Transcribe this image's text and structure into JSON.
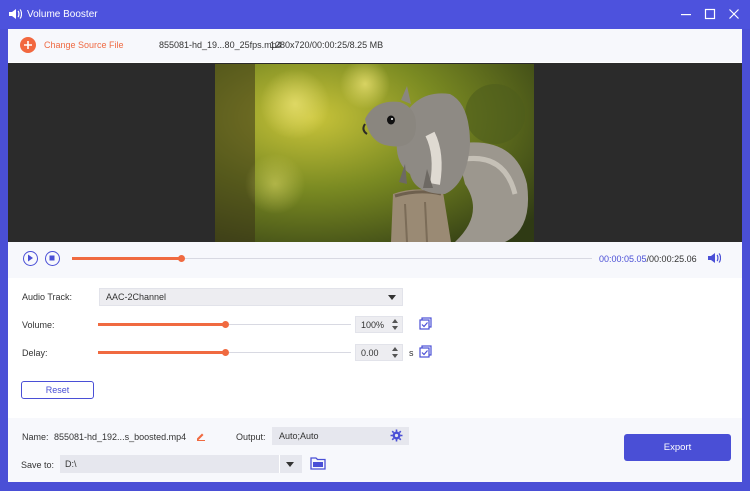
{
  "window": {
    "title": "Volume Booster"
  },
  "source": {
    "change_label": "Change Source File",
    "file_name": "855081-hd_19...80_25fps.mp4",
    "file_info": "1280x720/00:00:25/8.25 MB"
  },
  "player": {
    "current_time": "00:00:05.05",
    "total_time": "/00:00:25.06",
    "progress": 0.21
  },
  "settings": {
    "audio_track_label": "Audio Track:",
    "audio_track_value": "AAC-2Channel",
    "volume_label": "Volume:",
    "volume_value": "100%",
    "volume_level": 0.5,
    "delay_label": "Delay:",
    "delay_value": "0.00",
    "delay_unit": "s",
    "delay_level": 0.5,
    "reset_label": "Reset"
  },
  "output": {
    "name_label": "Name:",
    "name_value": "855081-hd_192...s_boosted.mp4",
    "output_label": "Output:",
    "output_value": "Auto;Auto",
    "save_label": "Save to:",
    "save_value": "D:\\",
    "export_label": "Export"
  },
  "colors": {
    "accent": "#4a4fd6",
    "orange": "#f06a40"
  }
}
